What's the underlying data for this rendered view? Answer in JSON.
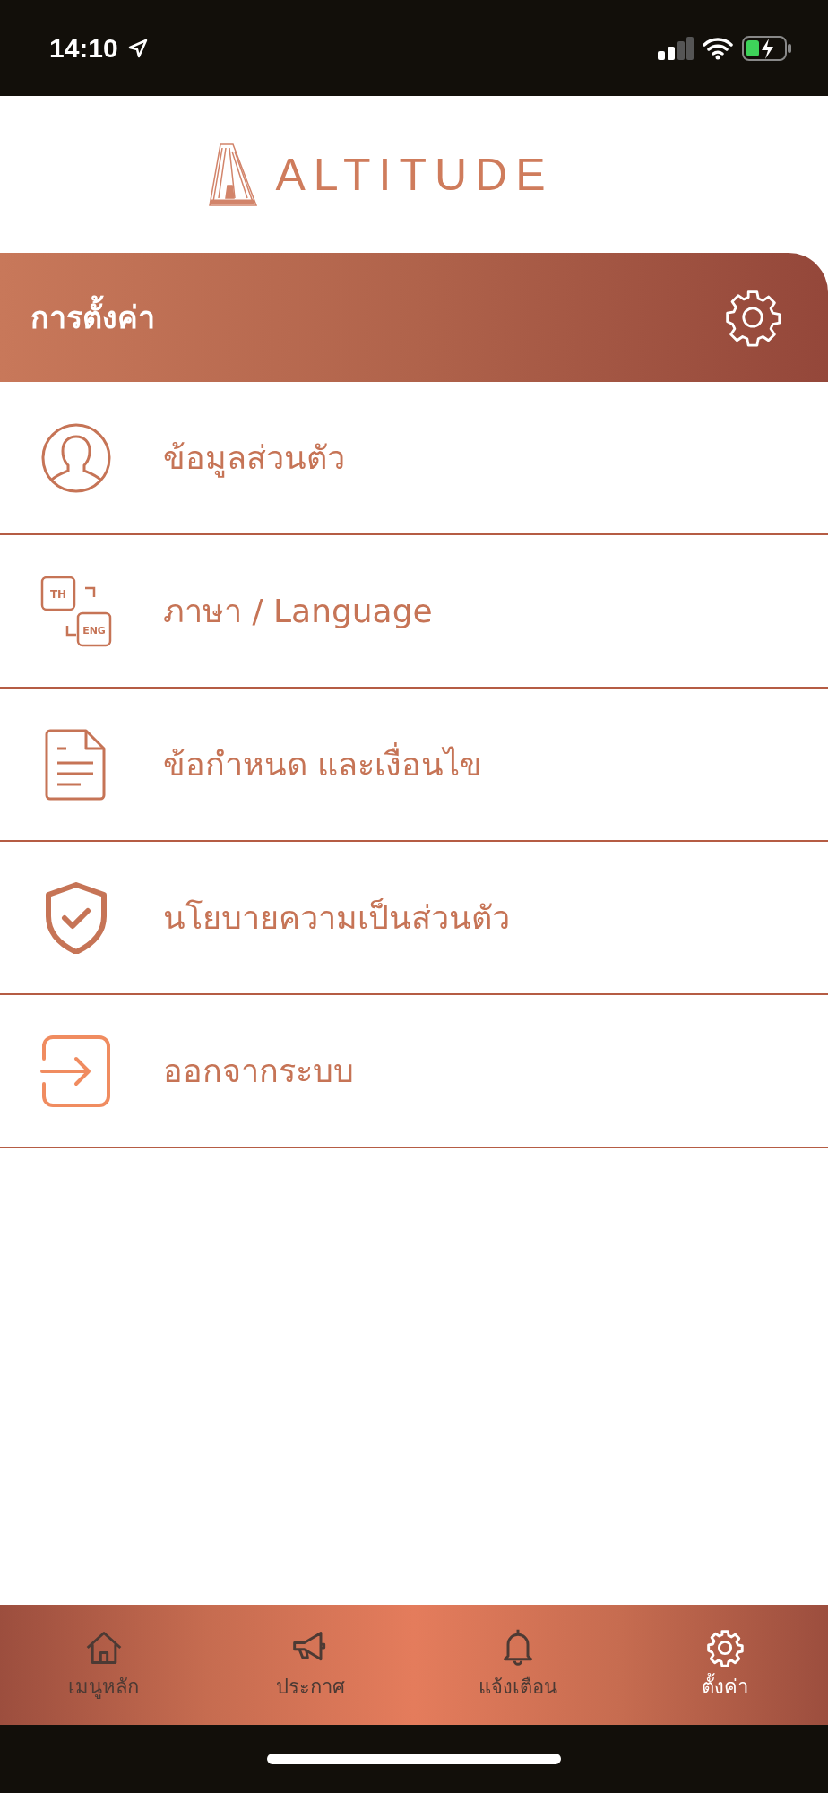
{
  "status_bar": {
    "time": "14:10"
  },
  "logo": {
    "text": "ALTITUDE"
  },
  "header": {
    "title": "การตั้งค่า"
  },
  "menu": [
    {
      "kind": "profile",
      "label": "ข้อมูลส่วนตัว"
    },
    {
      "kind": "language",
      "label": "ภาษา / Language",
      "icon_texts": [
        "TH",
        "ENG"
      ]
    },
    {
      "kind": "document",
      "label": "ข้อกำหนด และเงื่อนไข"
    },
    {
      "kind": "shield",
      "label": "นโยบายความเป็นส่วนตัว"
    },
    {
      "kind": "logout",
      "label": "ออกจากระบบ"
    }
  ],
  "tabs": [
    {
      "kind": "home",
      "label": "เมนูหลัก",
      "selected": false
    },
    {
      "kind": "megaphone",
      "label": "ประกาศ",
      "selected": false
    },
    {
      "kind": "bell",
      "label": "แจ้งเตือน",
      "selected": false
    },
    {
      "kind": "gear",
      "label": "ตั้งค่า",
      "selected": true
    }
  ]
}
